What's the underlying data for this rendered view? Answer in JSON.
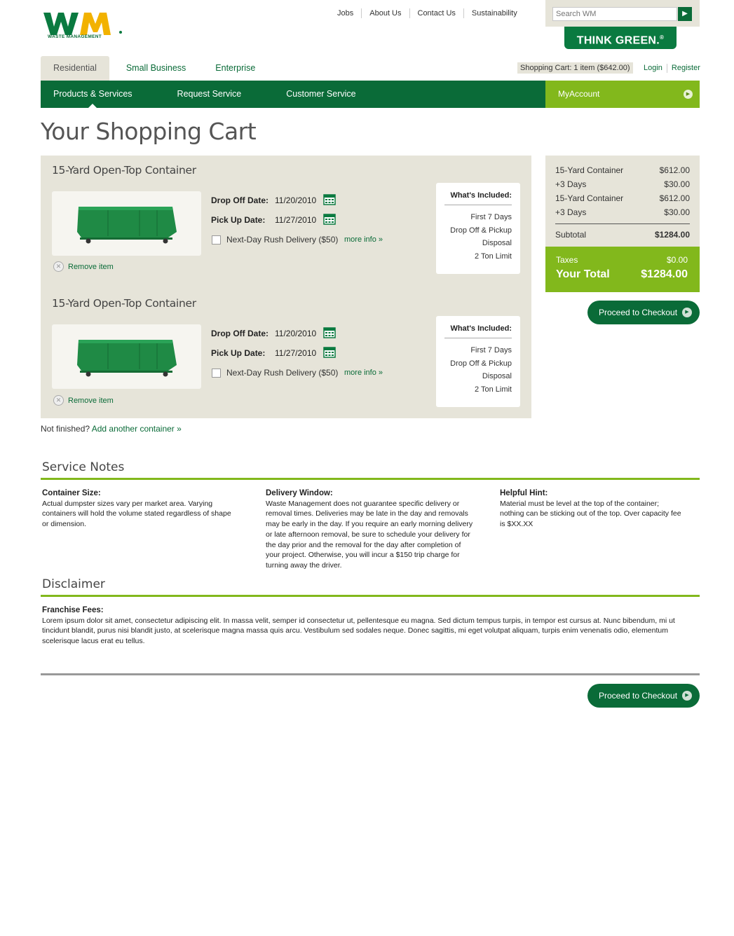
{
  "header": {
    "logo_text": "WASTE MANAGEMENT",
    "top_links": [
      "Jobs",
      "About Us",
      "Contact Us",
      "Sustainability"
    ],
    "search_placeholder": "Search WM",
    "think_green": "THINK GREEN.",
    "think_green_mark": "®"
  },
  "tabs": [
    "Residential",
    "Small Business",
    "Enterprise"
  ],
  "cart_info": "Shopping Cart: 1 item ($642.00)",
  "auth": {
    "login": "Login",
    "register": "Register"
  },
  "nav": {
    "items": [
      "Products & Services",
      "Request Service",
      "Customer Service"
    ],
    "my_account": "MyAccount"
  },
  "page_title": "Your Shopping Cart",
  "cart_items": [
    {
      "title": "15-Yard Open-Top Container",
      "drop_off_label": "Drop Off Date:",
      "drop_off": "11/20/2010",
      "pick_up_label": "Pick Up  Date:",
      "pick_up": "11/27/2010",
      "rush_label": "Next-Day Rush Delivery  ($50)",
      "more_info": "more info »",
      "included_title": "What's Included:",
      "included": [
        "First 7 Days",
        "Drop Off & Pickup",
        "Disposal",
        "2 Ton Limit"
      ],
      "remove": "Remove item"
    },
    {
      "title": "15-Yard Open-Top Container",
      "drop_off_label": "Drop Off Date:",
      "drop_off": "11/20/2010",
      "pick_up_label": "Pick Up  Date:",
      "pick_up": "11/27/2010",
      "rush_label": "Next-Day Rush Delivery  ($50)",
      "more_info": "more info »",
      "included_title": "What's Included:",
      "included": [
        "First 7 Days",
        "Drop Off & Pickup",
        "Disposal",
        "2 Ton Limit"
      ],
      "remove": "Remove item"
    }
  ],
  "not_finished": {
    "text": "Not finished?",
    "link": "Add another container »"
  },
  "summary": {
    "lines": [
      {
        "label": "15-Yard Container",
        "value": "$612.00"
      },
      {
        "label": "+3 Days",
        "value": "$30.00"
      },
      {
        "label": "15-Yard Container",
        "value": "$612.00"
      },
      {
        "label": "+3 Days",
        "value": "$30.00"
      }
    ],
    "subtotal_label": "Subtotal",
    "subtotal": "$1284.00",
    "taxes_label": "Taxes",
    "taxes": "$0.00",
    "total_label": "Your Total",
    "total": "$1284.00"
  },
  "checkout_label": "Proceed to Checkout",
  "service_notes": {
    "title": "Service Notes",
    "notes": [
      {
        "heading": "Container Size:",
        "body": "Actual dumpster sizes vary per market area. Varying containers will hold the volume stated regardless of shape or dimension."
      },
      {
        "heading": "Delivery Window:",
        "body": "Waste Management does not guarantee specific delivery or removal times. Deliveries may be late in the day and removals may be early in the day. If you require an early morning delivery or late afternoon removal, be sure to schedule your delivery for the day prior and the removal for the day after completion of your project. Otherwise, you will incur a $150 trip charge for turning away the driver."
      },
      {
        "heading": "Helpful Hint:",
        "body": "Material must be level at the top of the container; nothing can be sticking out of the top. Over capacity fee is $XX.XX"
      }
    ]
  },
  "disclaimer": {
    "title": "Disclaimer",
    "heading": "Franchise Fees:",
    "body": "Lorem ipsum dolor sit amet, consectetur adipiscing elit. In massa velit, semper id consectetur ut, pellentesque eu magna. Sed dictum tempus turpis, in tempor est cursus at. Nunc bibendum, mi ut tincidunt blandit, purus nisi blandit justo, at scelerisque magna massa quis arcu. Vestibulum sed sodales neque. Donec sagittis, mi eget volutpat aliquam, turpis enim venenatis odio, elementum scelerisque lacus erat eu tellus."
  },
  "colors": {
    "brand_green": "#0a6b38",
    "accent_lime": "#82b81c",
    "panel_beige": "#e6e4d9",
    "logo_yellow": "#f2b200"
  }
}
